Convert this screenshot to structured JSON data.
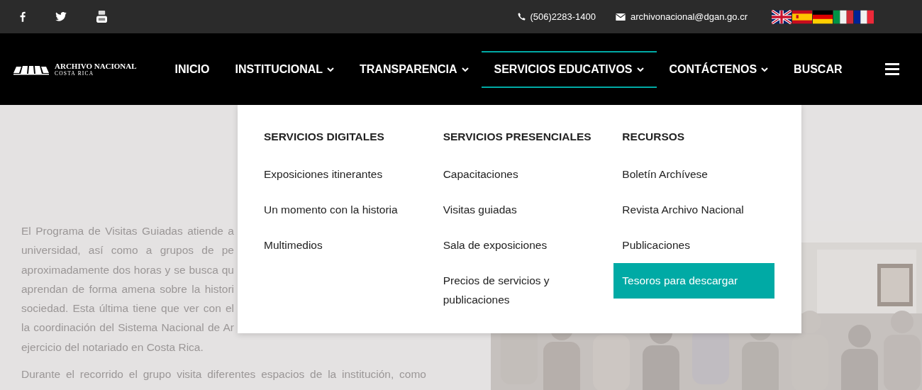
{
  "top_bar": {
    "phone": "(506)2283-1400",
    "email": "archivonacional@dgan.go.cr"
  },
  "logo": {
    "title": "ARCHIVO NACIONAL",
    "subtitle": "COSTA RICA"
  },
  "nav": [
    {
      "label": "INICIO",
      "has_submenu": false,
      "selected": false
    },
    {
      "label": "INSTITUCIONAL",
      "has_submenu": true,
      "selected": false
    },
    {
      "label": "TRANSPARENCIA",
      "has_submenu": true,
      "selected": false
    },
    {
      "label": "SERVICIOS EDUCATIVOS",
      "has_submenu": true,
      "selected": true
    },
    {
      "label": "CONTÁCTENOS",
      "has_submenu": true,
      "selected": false
    },
    {
      "label": "BUSCAR",
      "has_submenu": false,
      "selected": false
    }
  ],
  "dropdown": {
    "columns": [
      {
        "heading": "SERVICIOS DIGITALES",
        "items": [
          {
            "label": "Exposiciones itinerantes",
            "selected": false
          },
          {
            "label": "Un momento con la historia",
            "selected": false
          },
          {
            "label": "Multimedios",
            "selected": false
          }
        ]
      },
      {
        "heading": "SERVICIOS PRESENCIALES",
        "items": [
          {
            "label": "Capacitaciones",
            "selected": false
          },
          {
            "label": "Visitas guiadas",
            "selected": false
          },
          {
            "label": "Sala de exposiciones",
            "selected": false
          },
          {
            "label": "Precios de servicios y publicaciones",
            "selected": false
          }
        ]
      },
      {
        "heading": "RECURSOS",
        "items": [
          {
            "label": "Boletín Archívese",
            "selected": false
          },
          {
            "label": "Revista Archivo Nacional",
            "selected": false
          },
          {
            "label": "Publicaciones",
            "selected": false
          },
          {
            "label": "Tesoros para descargar",
            "selected": true
          }
        ]
      }
    ]
  },
  "content": {
    "paragraphs": [
      {
        "lines": [
          {
            "text": "El Programa de Visitas Guiadas atiende a",
            "kind": "partial"
          },
          {
            "text": "universidad, así como a grupos de pe",
            "kind": "partial"
          },
          {
            "text": "aproximadamente dos horas y se busca qu",
            "kind": "partial"
          },
          {
            "text": "aprendan de forma amena sobre la histori",
            "kind": "partial"
          },
          {
            "text": "sociedad. Esta última tiene que ver con el",
            "kind": "partial"
          },
          {
            "text": "la coordinación del Sistema Nacional de Ar",
            "kind": "partial"
          },
          {
            "text": "ejercicio del notariado en Costa Rica.",
            "kind": "end"
          }
        ]
      },
      {
        "lines": [
          {
            "text": "Durante el recorrido el grupo visita diferentes espacios de la institución, como",
            "kind": "full"
          }
        ]
      }
    ]
  }
}
